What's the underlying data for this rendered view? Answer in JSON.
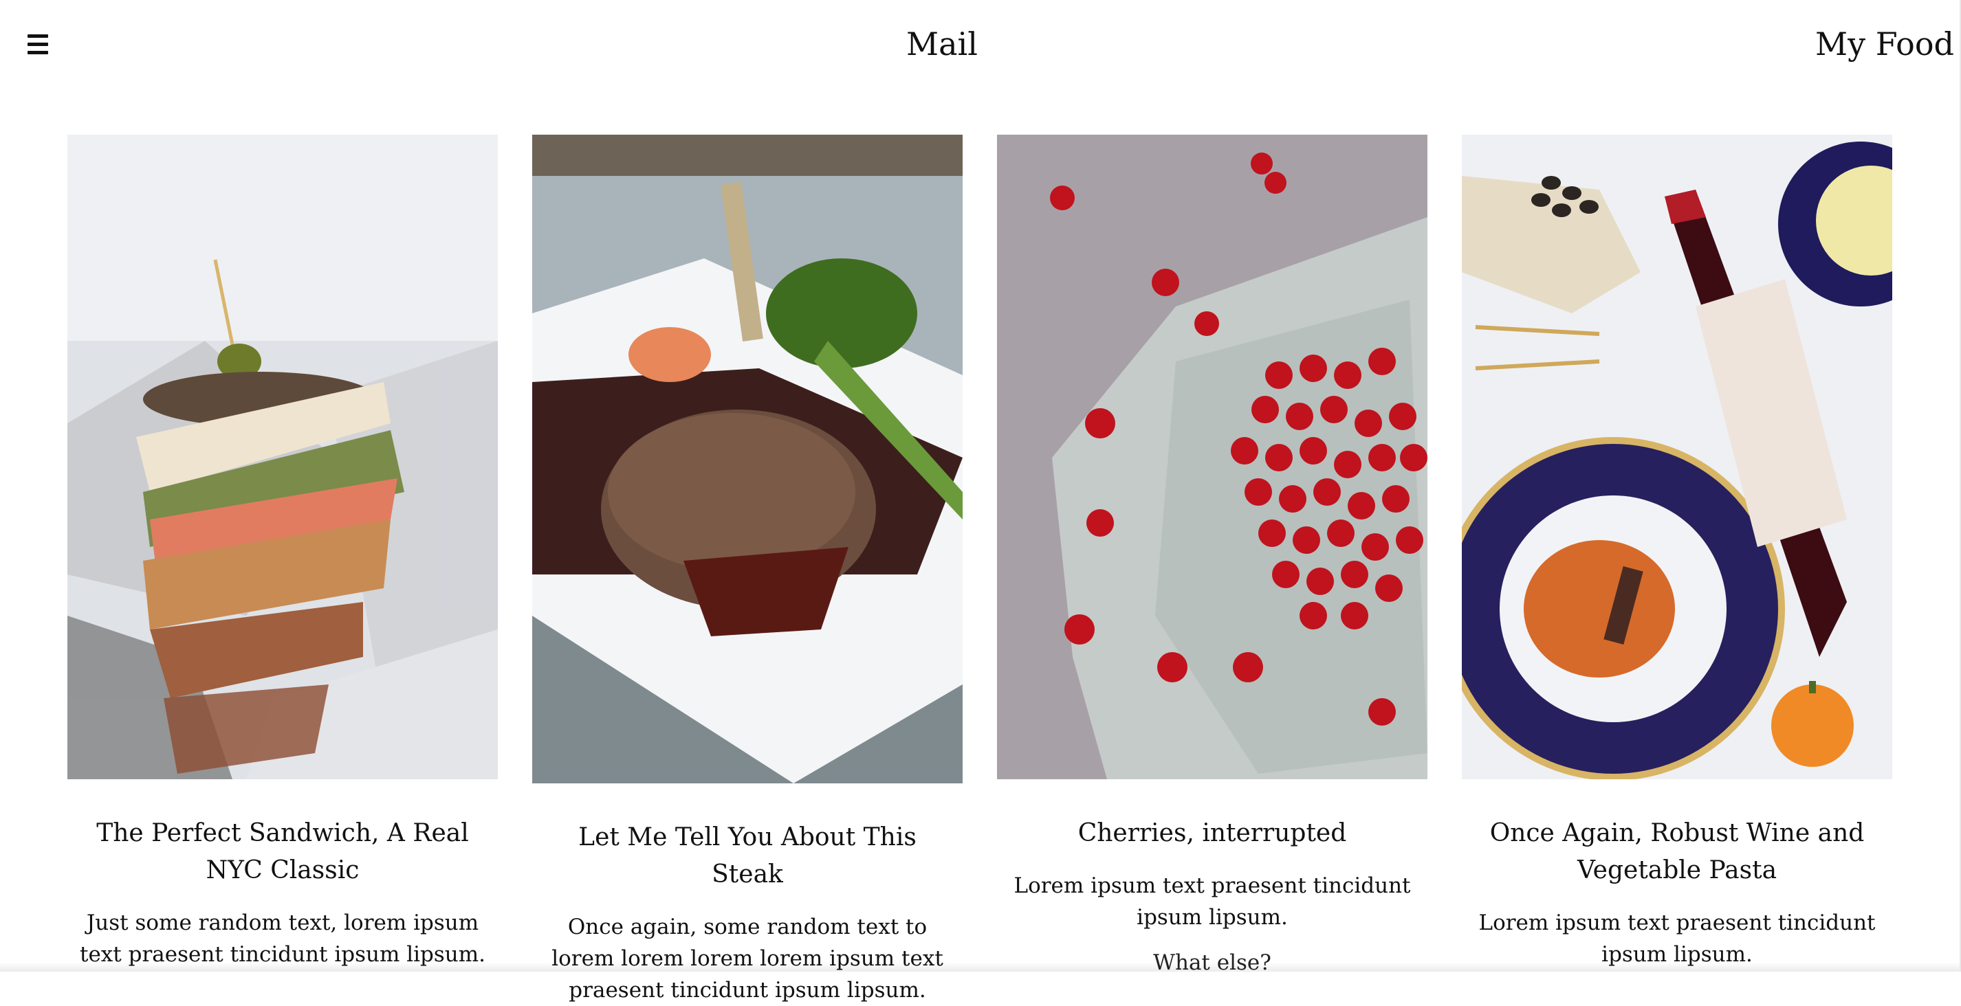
{
  "header": {
    "menu_icon": "hamburger-menu-icon",
    "center_title": "Mail",
    "right_title": "My Food"
  },
  "cards": [
    {
      "title": "The Perfect Sandwich, A Real NYC Classic",
      "text": "Just some random text, lorem ipsum text praesent tincidunt ipsum lipsum.",
      "extra": ""
    },
    {
      "title": "Let Me Tell You About This Steak",
      "text": "Once again, some random text to lorem lorem lorem lorem ipsum text praesent tincidunt ipsum lipsum.",
      "extra": ""
    },
    {
      "title": "Cherries, interrupted",
      "text": "Lorem ipsum text praesent tincidunt ipsum lipsum.",
      "extra": "What else?"
    },
    {
      "title": "Once Again, Robust Wine and Vegetable Pasta",
      "text": "Lorem ipsum text praesent tincidunt ipsum lipsum.",
      "extra": ""
    }
  ],
  "colors": {
    "background": "#ffffff",
    "text": "#111111"
  }
}
